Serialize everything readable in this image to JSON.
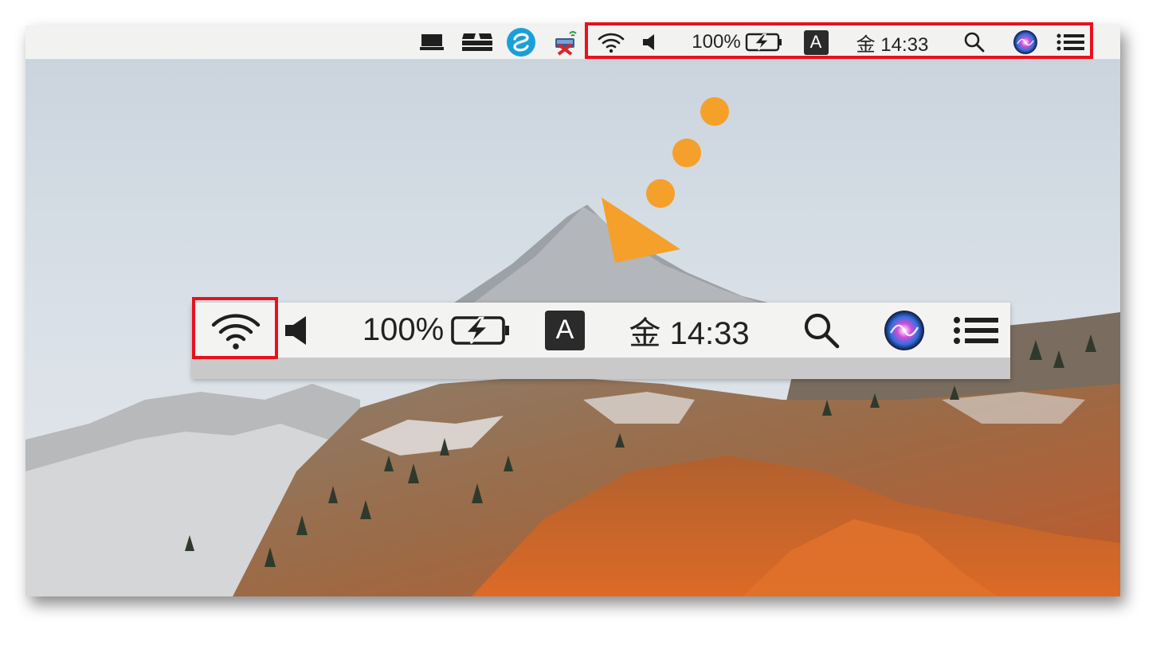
{
  "menubar": {
    "status_items": [
      {
        "icon": "display-mirror-icon"
      },
      {
        "icon": "dropbox-icon"
      },
      {
        "icon": "seagate-sync-icon"
      },
      {
        "icon": "vpn-disconnected-icon"
      }
    ],
    "wifi_icon": "wifi-icon",
    "volume_icon": "speaker-icon",
    "battery_percent": "100%",
    "battery_icon": "battery-charging-icon",
    "input_source": "A",
    "clock": "金 14:33",
    "spotlight_icon": "magnifier-icon",
    "siri_icon": "siri-icon",
    "notification_icon": "notification-center-icon"
  },
  "zoom_callout": {
    "battery_percent": "100%",
    "input_source": "A",
    "clock": "金 14:33"
  },
  "colors": {
    "highlight_red": "#e8111c",
    "arrow_orange": "#f5a02a",
    "menubar_bg": "#f2f2f1"
  }
}
